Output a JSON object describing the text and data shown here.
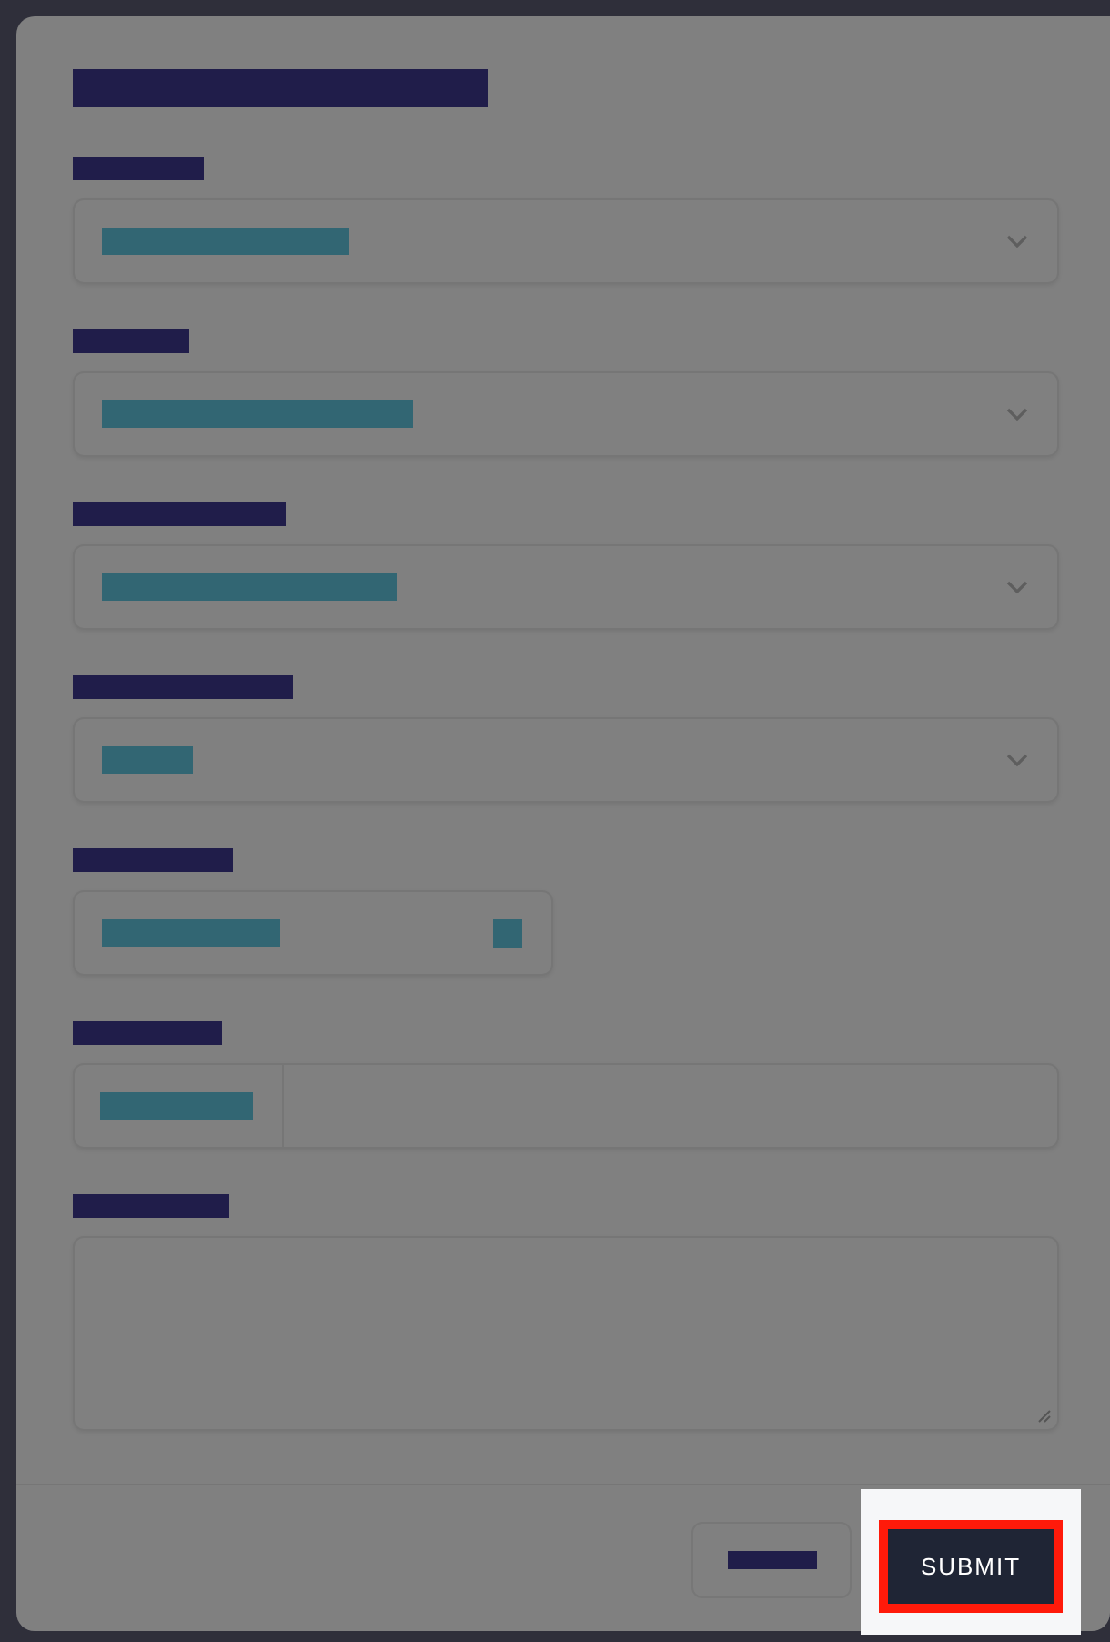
{
  "dialog": {
    "fields": [
      {
        "kind": "select"
      },
      {
        "kind": "select"
      },
      {
        "kind": "select"
      },
      {
        "kind": "select"
      },
      {
        "kind": "input_icon"
      },
      {
        "kind": "input_prefix"
      },
      {
        "kind": "textarea"
      }
    ],
    "buttons": [
      {
        "kind": "secondary"
      },
      {
        "kind": "primary",
        "label": "SUBMIT",
        "highlighted": true
      }
    ]
  }
}
